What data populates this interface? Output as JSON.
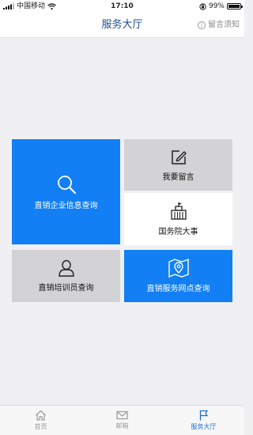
{
  "status_bar": {
    "signal_icon": "signal-bars-icon",
    "carrier": "中国移动",
    "wifi_icon": "wifi-icon",
    "time": "17:10",
    "lock_icon": "orientation-lock-icon",
    "battery_text": "99%",
    "battery_level": 0.99
  },
  "nav": {
    "title": "服务大厅",
    "notice_icon": "info-icon",
    "notice_label": "留言须知"
  },
  "tiles": {
    "enterprise_query": {
      "label": "直销企业信息查询",
      "icon": "search-icon"
    },
    "leave_message": {
      "label": "我要留言",
      "icon": "edit-icon"
    },
    "state_council": {
      "label": "国务院大事",
      "icon": "building-icon"
    },
    "trainer_query": {
      "label": "直销培训员查询",
      "icon": "person-icon"
    },
    "service_outlets": {
      "label": "直销服务网点查询",
      "icon": "map-pin-icon"
    }
  },
  "tab_bar": {
    "home_label": "首页",
    "mail_label": "邮箱",
    "service_label": "服务大厅",
    "active_color": "#1e6ed0"
  },
  "colors": {
    "accent_blue": "#127ff5",
    "tile_gray": "#d3d3d5",
    "title_blue": "#1e4d8f"
  }
}
